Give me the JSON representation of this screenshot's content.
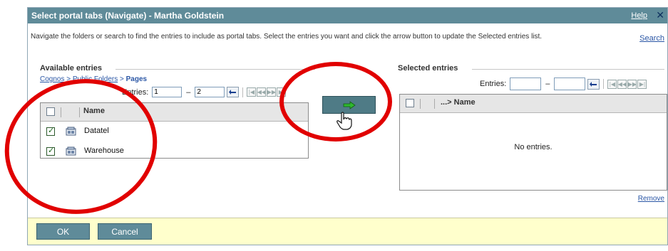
{
  "dialog": {
    "title": "Select portal tabs (Navigate) - Martha Goldstein",
    "help_label": "Help",
    "close_glyph": "✕",
    "instructions": "Navigate the folders or search to find the entries to include as portal tabs. Select the entries you want and click the arrow button to update the Selected entries list.",
    "search_label": "Search"
  },
  "available": {
    "section_label": "Available entries",
    "breadcrumb": {
      "cognos": "Cognos",
      "sep1": " > ",
      "public_folders": "Public Folders",
      "sep2": " > ",
      "current": "Pages"
    },
    "entries_label": "Entries:",
    "entries_from": "1",
    "entries_to": "2",
    "column_name": "Name",
    "rows": [
      {
        "name": "Datatel",
        "checked": true
      },
      {
        "name": "Warehouse",
        "checked": true
      }
    ]
  },
  "selected": {
    "section_label": "Selected entries",
    "entries_label": "Entries:",
    "entries_from": "",
    "entries_to": "",
    "column_name": "...> Name",
    "empty_text": "No entries.",
    "remove_label": "Remove"
  },
  "footer": {
    "ok_label": "OK",
    "cancel_label": "Cancel"
  },
  "icons": {
    "go": "go-arrow-icon",
    "pager": [
      "first-page-icon",
      "previous-page-icon",
      "next-page-icon",
      "last-page-icon"
    ],
    "move": "right-arrow-icon",
    "entry": "package-icon",
    "cursor": "hand-pointer-icon"
  },
  "colors": {
    "accent": "#5f8b99",
    "link": "#2a56a5",
    "footer_bg": "#ffffcc",
    "annotation": "#e10000",
    "arrow_green": "#2fb82f"
  }
}
